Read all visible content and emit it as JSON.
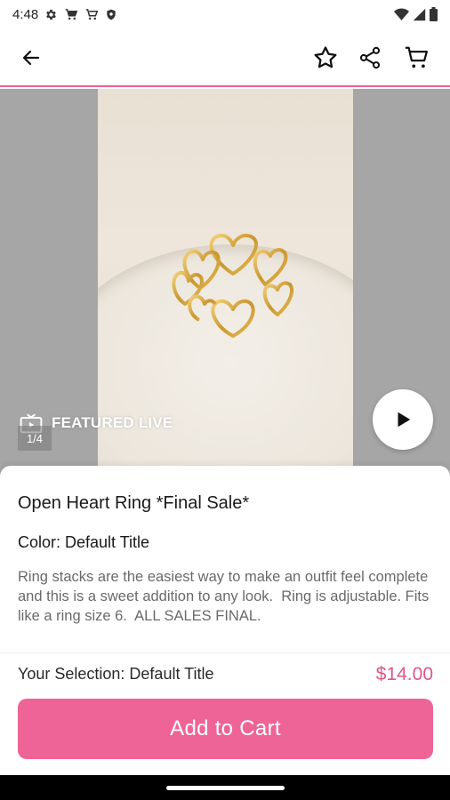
{
  "status_bar": {
    "time": "4:48",
    "left_icons": [
      "gear-icon",
      "cart-icon",
      "cart-icon",
      "shield-icon"
    ],
    "right_icons": [
      "wifi-icon",
      "signal-icon",
      "battery-icon"
    ]
  },
  "app_bar": {
    "icons": [
      "arrow-left-icon",
      "star-icon",
      "share-icon",
      "cart-icon"
    ],
    "accent_color": "#ec5f90"
  },
  "media": {
    "badge_label": "FEATURED LIVE",
    "counter": "1/4",
    "play_icon": "play-icon"
  },
  "product": {
    "title": "Open Heart Ring *Final Sale*",
    "color_label": "Color: Default Title",
    "description": "Ring stacks are the easiest way to make an outfit feel complete and this is a sweet addition to any look.  Ring is adjustable. Fits like a ring size 6.  ALL SALES FINAL.",
    "selection_label": "Your Selection: Default Title",
    "price": "$14.00",
    "price_color": "#e0558a"
  },
  "actions": {
    "add_to_cart_label": "Add to Cart",
    "button_color": "#ef6496"
  }
}
